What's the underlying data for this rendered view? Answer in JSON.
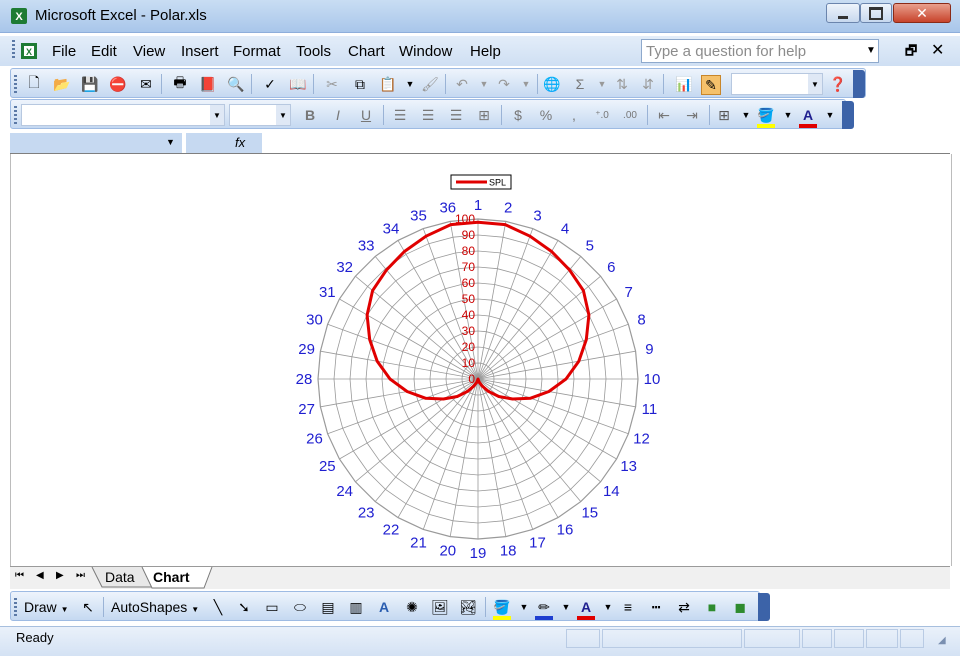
{
  "window": {
    "title": "Microsoft Excel - Polar.xls"
  },
  "menu": [
    "File",
    "Edit",
    "View",
    "Insert",
    "Format",
    "Tools",
    "Chart",
    "Window",
    "Help"
  ],
  "help_box": {
    "placeholder": "Type a question for help"
  },
  "tabs": [
    "Data",
    "Chart"
  ],
  "active_tab": "Chart",
  "drawing": {
    "draw_label": "Draw",
    "autoshapes_label": "AutoShapes"
  },
  "status": "Ready",
  "colors": {
    "series": "#e00000",
    "direction_labels": "#1f1fd0",
    "radial_labels": "#cc0000",
    "gridline": "#9a9a9a"
  },
  "chart_data": {
    "type": "radar",
    "legend": {
      "entries": [
        "SPL"
      ],
      "placement": "top"
    },
    "radial_axis": {
      "min": 0,
      "max": 100,
      "step": 10,
      "tick_labels": [
        "0",
        "10",
        "20",
        "30",
        "40",
        "50",
        "60",
        "70",
        "80",
        "90",
        "100"
      ]
    },
    "categories": [
      "1",
      "2",
      "3",
      "4",
      "5",
      "6",
      "7",
      "8",
      "9",
      "10",
      "11",
      "12",
      "13",
      "14",
      "15",
      "16",
      "17",
      "18",
      "19",
      "20",
      "21",
      "22",
      "23",
      "24",
      "25",
      "26",
      "27",
      "28",
      "29",
      "30",
      "31",
      "32",
      "33",
      "34",
      "35",
      "36"
    ],
    "series": [
      {
        "name": "SPL",
        "color": "#e00000",
        "values": [
          98,
          98,
          95,
          92,
          89,
          86,
          80,
          72,
          64,
          55,
          45,
          35,
          25,
          17,
          10,
          5,
          2,
          0,
          0,
          0,
          2,
          5,
          10,
          17,
          25,
          35,
          45,
          55,
          64,
          72,
          80,
          86,
          89,
          92,
          95,
          98
        ]
      }
    ]
  }
}
